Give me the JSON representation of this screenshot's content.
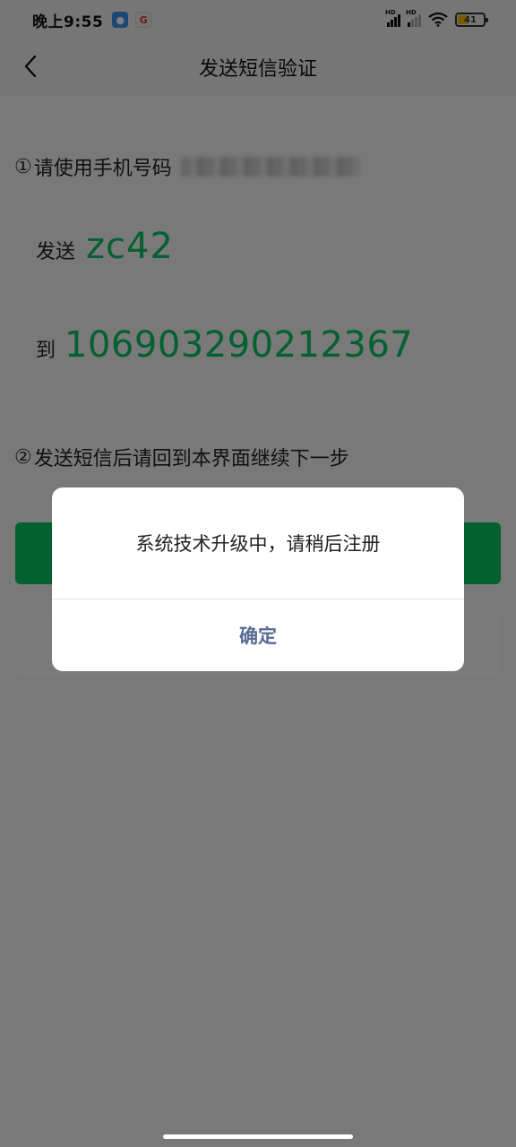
{
  "status_bar": {
    "time": "晚上9:55",
    "battery": "41",
    "hd_label": "HD",
    "accent_battery": "#f0b400"
  },
  "nav": {
    "title": "发送短信验证",
    "back_icon": "chevron-left-icon"
  },
  "steps": {
    "step1_num": "①",
    "step1_text": "请使用手机号码",
    "send_label": "发送",
    "code": "zc42",
    "to_label": "到",
    "number": "106903290212367",
    "step2_num": "②",
    "step2_text": "发送短信后请回到本界面继续下一步"
  },
  "dialog": {
    "message": "系统技术升级中，请稍后注册",
    "confirm_label": "确定"
  },
  "colors": {
    "accent_green": "#07c160",
    "link_blue": "#576b95",
    "overlay": "rgba(0,0,0,0.5)"
  }
}
